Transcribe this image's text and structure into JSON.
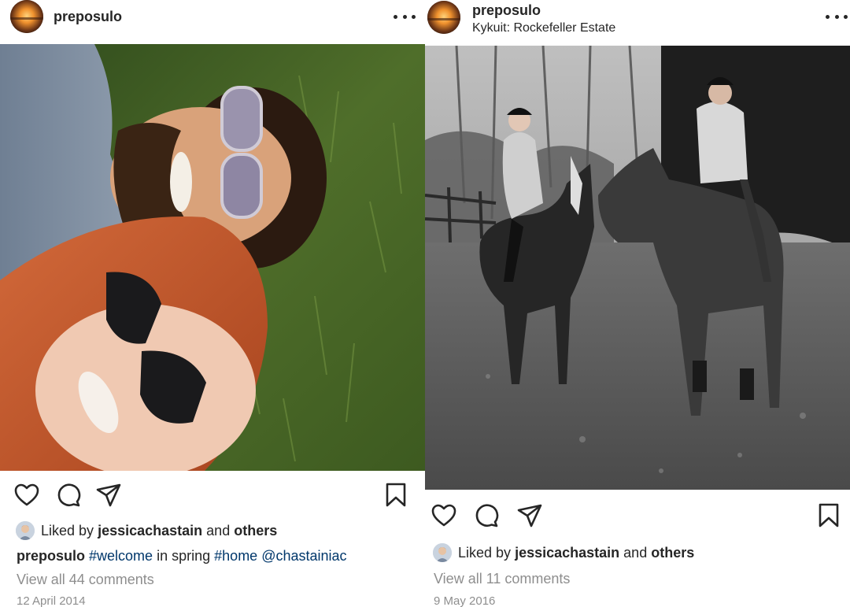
{
  "posts": [
    {
      "username": "preposulo",
      "location": "",
      "liked_by_prefix": "Liked by",
      "liked_by_user": "jessicachastain",
      "liked_by_and": "and",
      "liked_by_others": "others",
      "caption_user": "preposulo",
      "caption_tag1": "#welcome",
      "caption_text": "in spring",
      "caption_tag2": "#home",
      "caption_mention": "@chastainiac",
      "comments_link": "View all 44 comments",
      "date": "12 April 2014"
    },
    {
      "username": "preposulo",
      "location": "Kykuit: Rockefeller Estate",
      "liked_by_prefix": "Liked by",
      "liked_by_user": "jessicachastain",
      "liked_by_and": "and",
      "liked_by_others": "others",
      "comments_link": "View all 11 comments",
      "date": "9 May 2016"
    }
  ],
  "icons": {
    "more": "more-horizontal-icon",
    "like": "heart-icon",
    "comment": "comment-bubble-icon",
    "share": "paper-plane-icon",
    "save": "bookmark-icon"
  },
  "colors": {
    "text": "#262626",
    "secondary": "#8e8e8e",
    "link": "#00376b"
  }
}
